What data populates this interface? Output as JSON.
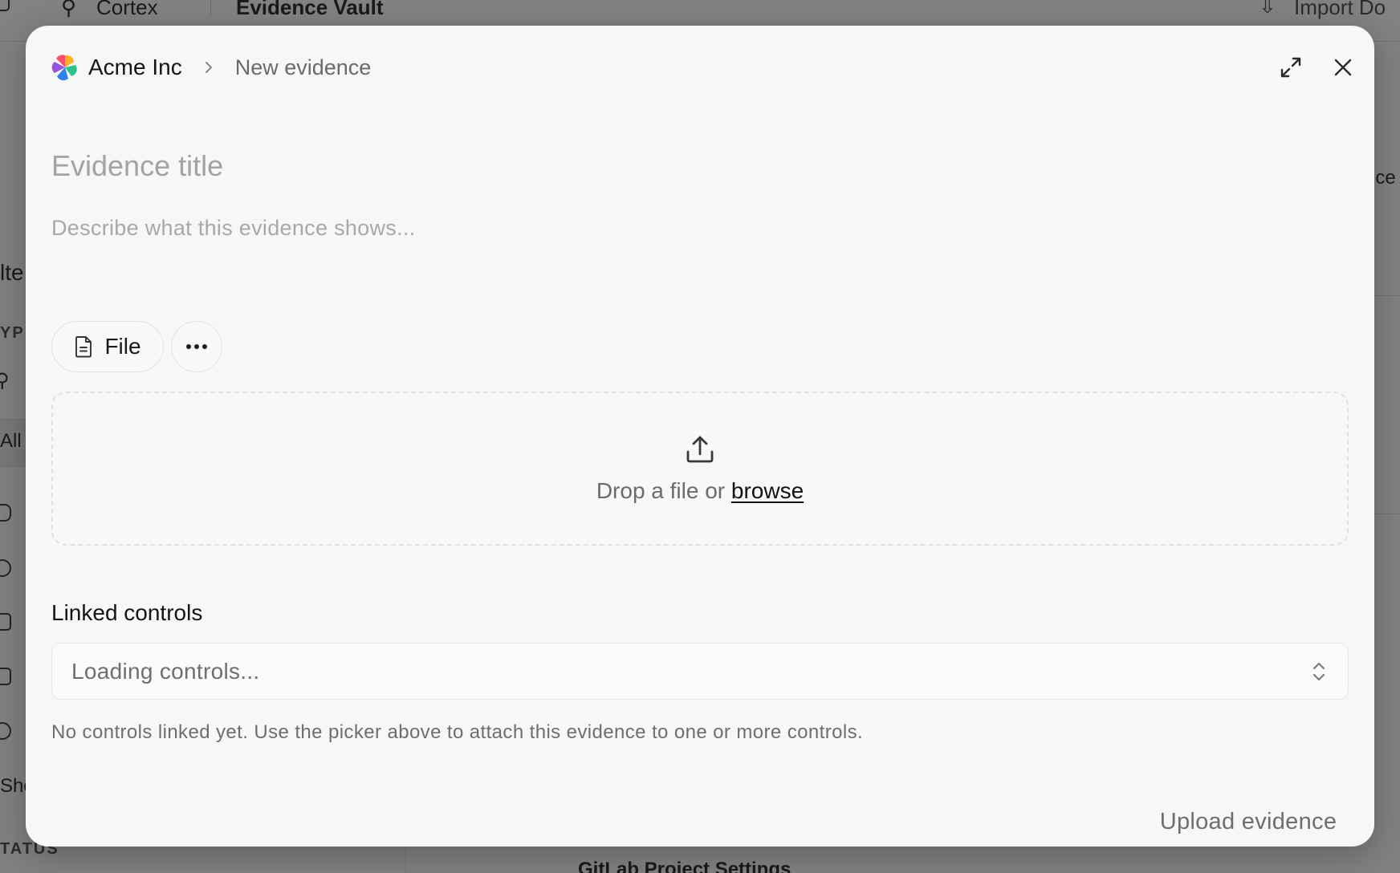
{
  "background": {
    "topbar": {
      "app_name": "Cortex",
      "section": "Evidence Vault",
      "import_label": "Import Do"
    },
    "sidebar": {
      "filters_fragment": "lte",
      "type_fragment": "YPE",
      "all_fragment": "All",
      "show_fragment": "Sho",
      "status_fragment": "TATUS"
    },
    "right_fragment": "nce",
    "list_fragment": "GitLab Project Settings"
  },
  "modal": {
    "breadcrumb": {
      "org": "Acme Inc",
      "page": "New evidence"
    },
    "title_placeholder": "Evidence title",
    "description_placeholder": "Describe what this evidence shows...",
    "type_chips": {
      "file_label": "File"
    },
    "dropzone": {
      "prefix": "Drop a file or ",
      "link": "browse"
    },
    "linked_controls": {
      "heading": "Linked controls",
      "select_value": "Loading controls...",
      "hint": "No controls linked yet. Use the picker above to attach this evidence to one or more controls."
    },
    "submit_label": "Upload evidence"
  },
  "icons": {
    "logo": "acme-logo-pinwheel",
    "chevron": "chevron-right-icon",
    "expand": "expand-icon",
    "close": "close-icon",
    "file": "file-icon",
    "more": "more-horizontal-icon",
    "upload": "upload-icon",
    "select": "chevrons-up-down-icon"
  },
  "colors": {
    "logo": [
      "#ff4d6d",
      "#ffb020",
      "#2bc48a",
      "#2f80ed",
      "#9b51e0"
    ]
  }
}
